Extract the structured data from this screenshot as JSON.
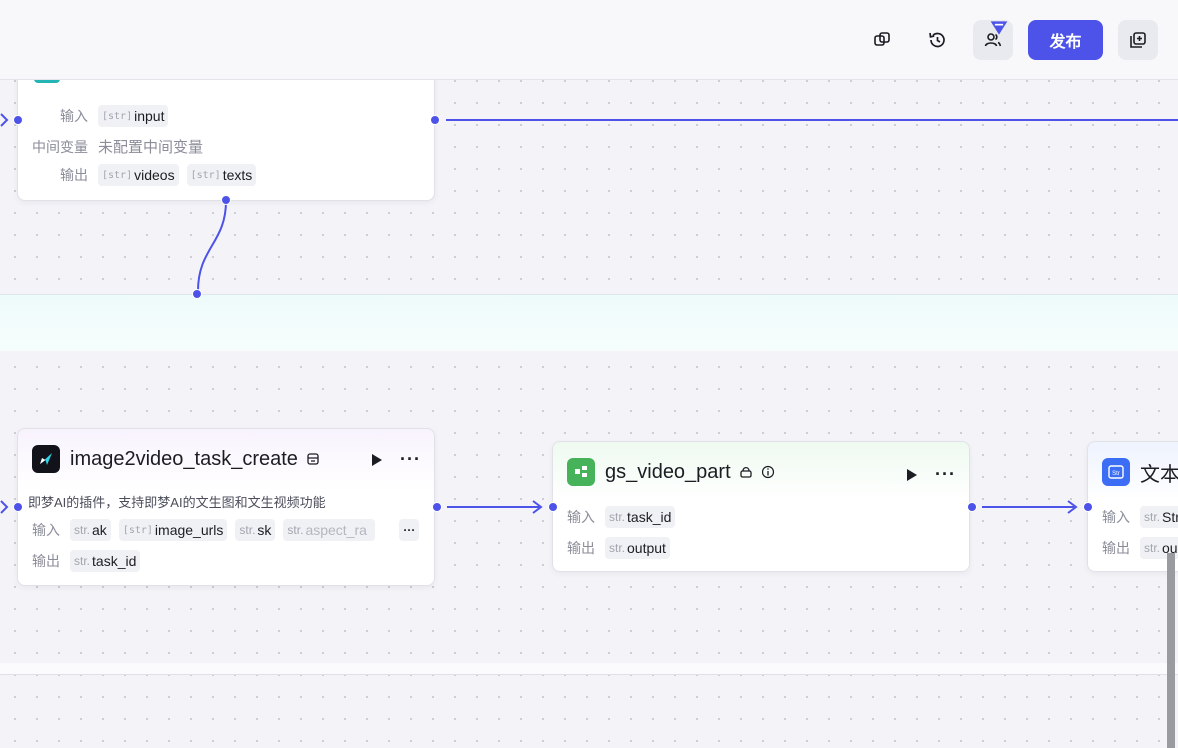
{
  "topbar": {
    "publish_label": "发布"
  },
  "node_top": {
    "input_label": "输入",
    "input_tags": [
      {
        "type": "[str]",
        "name": "input"
      }
    ],
    "var_label": "中间变量",
    "var_value": "未配置中间变量",
    "output_label": "输出",
    "output_tags": [
      {
        "type": "[str]",
        "name": "videos"
      },
      {
        "type": "[str]",
        "name": "texts"
      }
    ]
  },
  "node_image2video": {
    "title": "image2video_task_create",
    "description": "即梦AI的插件，支持即梦AI的文生图和文生视频功能",
    "input_label": "输入",
    "input_tags": [
      {
        "type": "str.",
        "name": "ak"
      },
      {
        "type": "[str]",
        "name": "image_urls"
      },
      {
        "type": "str.",
        "name": "sk"
      },
      {
        "type": "str.",
        "name": "aspect_ra"
      }
    ],
    "more_label": "···",
    "output_label": "输出",
    "output_tags": [
      {
        "type": "str.",
        "name": "task_id"
      }
    ]
  },
  "node_gs_video": {
    "title": "gs_video_part",
    "input_label": "输入",
    "input_tags": [
      {
        "type": "str.",
        "name": "task_id"
      }
    ],
    "output_label": "输出",
    "output_tags": [
      {
        "type": "str.",
        "name": "output"
      }
    ]
  },
  "node_text": {
    "title": "文本",
    "input_label": "输入",
    "input_tags": [
      {
        "type": "str.",
        "name": "Str"
      }
    ],
    "output_label": "输出",
    "output_tags": [
      {
        "type": "str.",
        "name": "ou"
      }
    ]
  },
  "colors": {
    "accent": "#4d53e8",
    "canvas": "#f4f4f8",
    "gs_icon": "#46b35a",
    "text_icon": "#3b6ef5"
  },
  "icons": [
    "copy-icon",
    "history-icon",
    "collaborators-icon",
    "add-window-icon",
    "play-icon",
    "more-icon",
    "store-icon",
    "info-icon",
    "lock-icon"
  ]
}
